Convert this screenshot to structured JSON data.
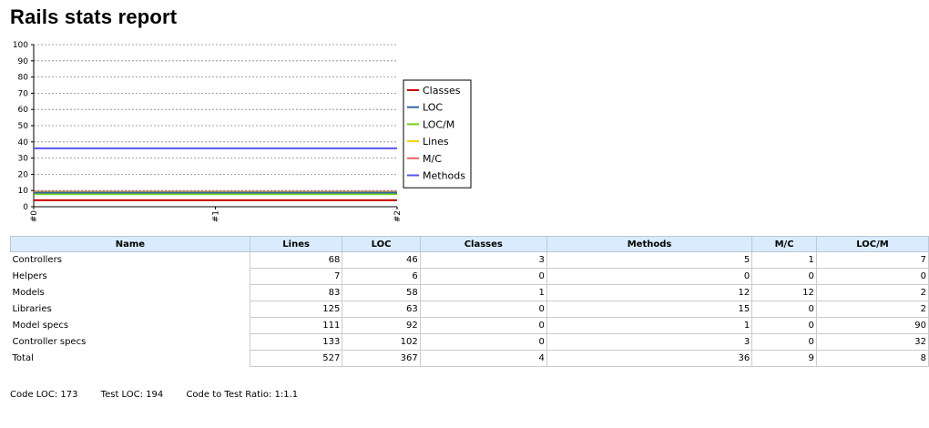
{
  "page": {
    "title": "Rails stats report"
  },
  "chart_data": {
    "type": "line",
    "x": [
      "#0",
      "#1",
      "#2"
    ],
    "ylim": [
      0,
      100
    ],
    "yticks": [
      0,
      10,
      20,
      30,
      40,
      50,
      60,
      70,
      80,
      90,
      100
    ],
    "grid": true,
    "legend_position": "right",
    "series": [
      {
        "name": "Classes",
        "color": "#cc0000",
        "values": [
          4,
          4,
          4
        ]
      },
      {
        "name": "LOC",
        "color": "#3465a4",
        "values": [
          8.7,
          8.7,
          8.7
        ]
      },
      {
        "name": "LOC/M",
        "color": "#73d216",
        "values": [
          7.8,
          7.8,
          7.8
        ]
      },
      {
        "name": "Lines",
        "color": "#edd400",
        "values": [
          8.9,
          8.9,
          8.9
        ]
      },
      {
        "name": "M/C",
        "color": "#ef6060",
        "values": [
          9.3,
          9.3,
          9.3
        ]
      },
      {
        "name": "Methods",
        "color": "#5555ee",
        "values": [
          36,
          36,
          36
        ]
      }
    ]
  },
  "table": {
    "headers": [
      "Name",
      "Lines",
      "LOC",
      "Classes",
      "Methods",
      "M/C",
      "LOC/M"
    ],
    "rows": [
      [
        "Controllers",
        "68",
        "46",
        "3",
        "5",
        "1",
        "7"
      ],
      [
        "Helpers",
        "7",
        "6",
        "0",
        "0",
        "0",
        "0"
      ],
      [
        "Models",
        "83",
        "58",
        "1",
        "12",
        "12",
        "2"
      ],
      [
        "Libraries",
        "125",
        "63",
        "0",
        "15",
        "0",
        "2"
      ],
      [
        "Model specs",
        "111",
        "92",
        "0",
        "1",
        "0",
        "90"
      ],
      [
        "Controller specs",
        "133",
        "102",
        "0",
        "3",
        "0",
        "32"
      ],
      [
        "Total",
        "527",
        "367",
        "4",
        "36",
        "9",
        "8"
      ]
    ]
  },
  "summary": {
    "code_loc": "Code LOC: 173",
    "test_loc": "Test LOC: 194",
    "ratio": "Code to Test Ratio: 1:1.1"
  }
}
